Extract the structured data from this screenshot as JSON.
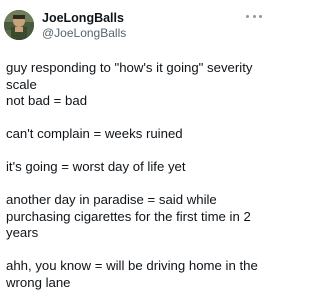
{
  "author": {
    "display_name": "JoeLongBalls",
    "handle": "@JoeLongBalls",
    "avatar_icon": "avatar-icon"
  },
  "actions": {
    "more_icon": "more-horizontal-icon"
  },
  "tweet": {
    "paragraphs": [
      [
        "guy responding to \"how's it going\" severity",
        "scale",
        "not bad = bad"
      ],
      [
        "can't complain = weeks ruined"
      ],
      [
        "it's going = worst day of life yet"
      ],
      [
        "another day in paradise = said while",
        "purchasing cigarettes for the first time in 2",
        "years"
      ],
      [
        "ahh, you know = will be driving home in the",
        "wrong lane"
      ]
    ]
  },
  "colors": {
    "text": "#0f1419",
    "secondary": "#536471"
  }
}
